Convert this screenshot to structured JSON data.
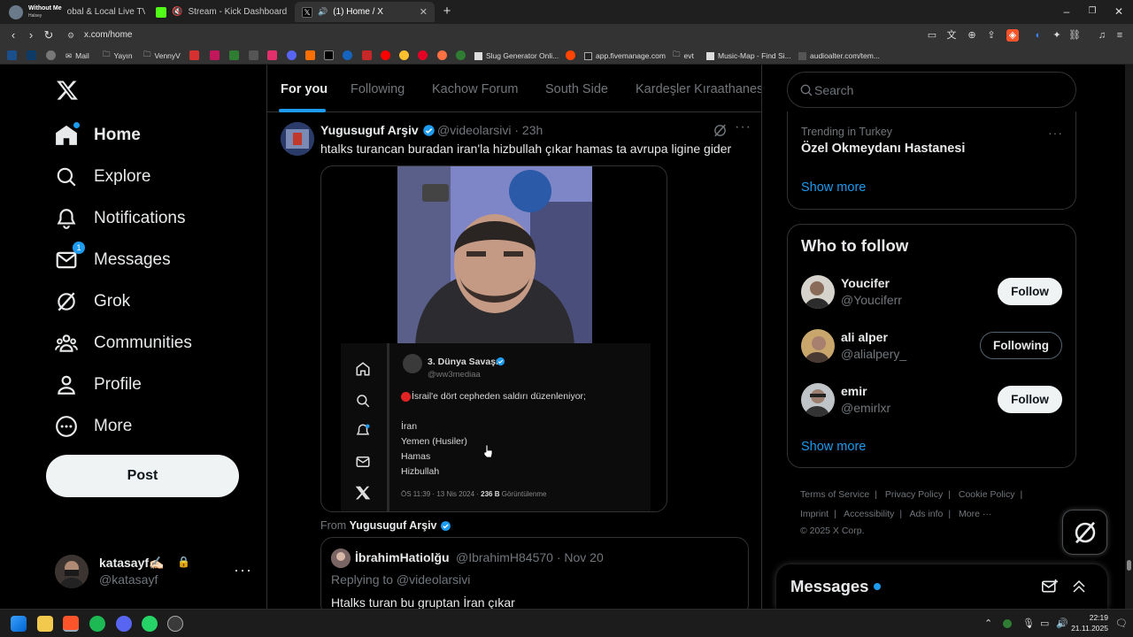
{
  "browser": {
    "tabs": [
      {
        "label": "obal & Local Live TV On",
        "media_title": "Without Me",
        "media_artist": "Halsey",
        "active": false
      },
      {
        "label": "Stream - Kick Dashboard",
        "active": false
      },
      {
        "label": "(1) Home / X",
        "active": true
      }
    ],
    "new_tab": "+",
    "url": "x.com/home",
    "bookmarks": [
      "Mail",
      "Yayın",
      "VennyV",
      "Slug Generator Onli...",
      "app.fivemanage.com",
      "evt",
      "Music-Map - Find Si...",
      "audioalter.com/tem..."
    ]
  },
  "sidebar": {
    "items": [
      {
        "label": "Home",
        "icon": "home-icon",
        "active": true
      },
      {
        "label": "Explore",
        "icon": "search-icon"
      },
      {
        "label": "Notifications",
        "icon": "bell-icon"
      },
      {
        "label": "Messages",
        "icon": "mail-icon",
        "badge": "1"
      },
      {
        "label": "Grok",
        "icon": "grok-icon"
      },
      {
        "label": "Communities",
        "icon": "communities-icon"
      },
      {
        "label": "Profile",
        "icon": "profile-icon"
      },
      {
        "label": "More",
        "icon": "more-circle-icon"
      }
    ],
    "post_label": "Post",
    "account": {
      "name": "katasayf✍🏻",
      "handle": "@katasayf"
    }
  },
  "feed": {
    "tabs": [
      "For you",
      "Following",
      "Kachow Forum",
      "South Side",
      "Kardeşler Kıraathanesi"
    ],
    "tweet": {
      "name": "Yugusuguf Arşiv",
      "handle": "@videolarsivi",
      "time": "23h",
      "meta": "@videolarsivi · 23h",
      "text": "htalks turancan buradan iran'la hizbullah çıkar hamas ta avrupa ligine gider",
      "media": {
        "embedded_name": "3. Dünya Savaşı",
        "embedded_handle": "@ww3mediaa",
        "embedded_headline": "İsrail'e dört cepheden saldırı düzenleniyor;",
        "embedded_list": [
          "İran",
          "Yemen (Husiler)",
          "Hamas",
          "Hizbullah"
        ],
        "embedded_footer_time": "ÖS 11:39 · 13 Nis 2024 ·",
        "embedded_footer_views": "236 B",
        "embedded_footer_views_label": "Görüntülenme"
      },
      "from_prefix": "From",
      "from_name": "Yugusuguf Arşiv",
      "quote": {
        "name": "İbrahimHatiolğu",
        "meta": "@IbrahimH84570 · Nov 20",
        "replying": "Replying to @videolarsivi",
        "text": "Htalks turan bu gruptan  İran çıkar"
      }
    }
  },
  "right": {
    "search_placeholder": "Search",
    "trend": {
      "context": "Trending in Turkey",
      "name": "Özel Okmeydanı Hastanesi",
      "show_more": "Show more"
    },
    "who_to_follow": {
      "title": "Who to follow",
      "users": [
        {
          "name": "Youcifer",
          "handle": "@Youciferr",
          "button": "Follow"
        },
        {
          "name": "ali alper",
          "handle": "@alialpery_",
          "button": "Following"
        },
        {
          "name": "emir",
          "handle": "@emirlxr",
          "button": "Follow"
        }
      ],
      "show_more": "Show more"
    },
    "footer": {
      "links": [
        "Terms of Service",
        "Privacy Policy",
        "Cookie Policy",
        "Imprint",
        "Accessibility",
        "Ads info",
        "More ···"
      ],
      "copyright": "© 2025 X Corp."
    },
    "messages_drawer": "Messages"
  },
  "taskbar": {
    "time": "22:19",
    "date": "21.11.2025"
  },
  "colors": {
    "accent": "#1d9bf0",
    "background": "#000000",
    "text": "#e7e9ea",
    "muted": "#71767b",
    "border": "#2f3336"
  }
}
